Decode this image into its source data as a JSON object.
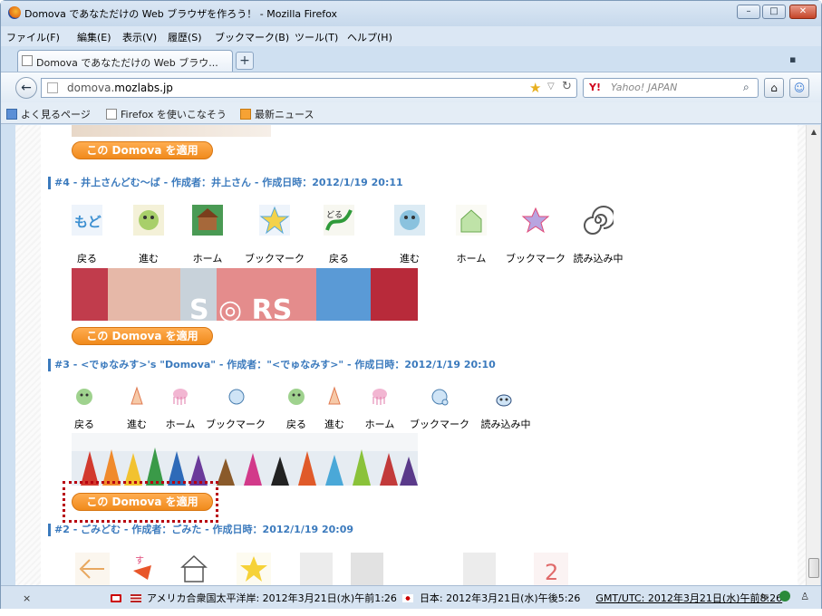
{
  "window": {
    "title": "Domova であなただけの Web ブラウザを作ろう！ - Mozilla Firefox",
    "minimize_label": "–",
    "maximize_label": "□",
    "close_label": "✕"
  },
  "menu": [
    "ファイル(F)",
    "編集(E)",
    "表示(V)",
    "履歴(S)",
    "ブックマーク(B)",
    "ツール(T)",
    "ヘルプ(H)"
  ],
  "tab": {
    "title": "Domova であなただけの Web ブラウ...",
    "new_tab_label": "+",
    "list_label": "▪"
  },
  "nav": {
    "url_host": "domova.",
    "url_domain": "mozlabs.jp",
    "search_placeholder": "Yahoo! JAPAN",
    "search_engine": "Y!"
  },
  "bookmarks": [
    "よく見るページ",
    "Firefox を使いこなそう",
    "最新ニュース"
  ],
  "apply_label": "この Domova を適用",
  "sections": [
    {
      "header": "#4 - 井上さんどむ〜ば - 作成者：井上さん - 作成日時：2012/1/19 20:11",
      "labels": [
        "戻る",
        "進む",
        "ホーム",
        "ブックマーク",
        "戻る",
        "進む",
        "ホーム",
        "ブックマーク",
        "読み込み中"
      ]
    },
    {
      "header": "#3 - <でゅなみす>'s \"Domova\" - 作成者：\"<でゅなみす>\" - 作成日時：2012/1/19 20:10",
      "labels": [
        "戻る",
        "進む",
        "ホーム",
        "ブックマーク",
        "戻る",
        "進む",
        "ホーム",
        "ブックマーク",
        "読み込み中"
      ]
    },
    {
      "header": "#2 - ごみどむ - 作成者：ごみた - 作成日時：2012/1/19 20:09",
      "labels": []
    }
  ],
  "banner_text": "S ◎ RS",
  "status": {
    "close_label": "×",
    "pacific": "アメリカ合衆国太平洋岸: 2012年3月21日(水)午前1:26",
    "japan": "日本: 2012年3月21日(水)午後5:26",
    "gmt": "GMT/UTC: 2012年3月21日(水)午前8:26"
  },
  "colors": {
    "accent": "#3b7abd",
    "apply_button": "#f08a1c",
    "highlight_box": "#b8000f"
  }
}
